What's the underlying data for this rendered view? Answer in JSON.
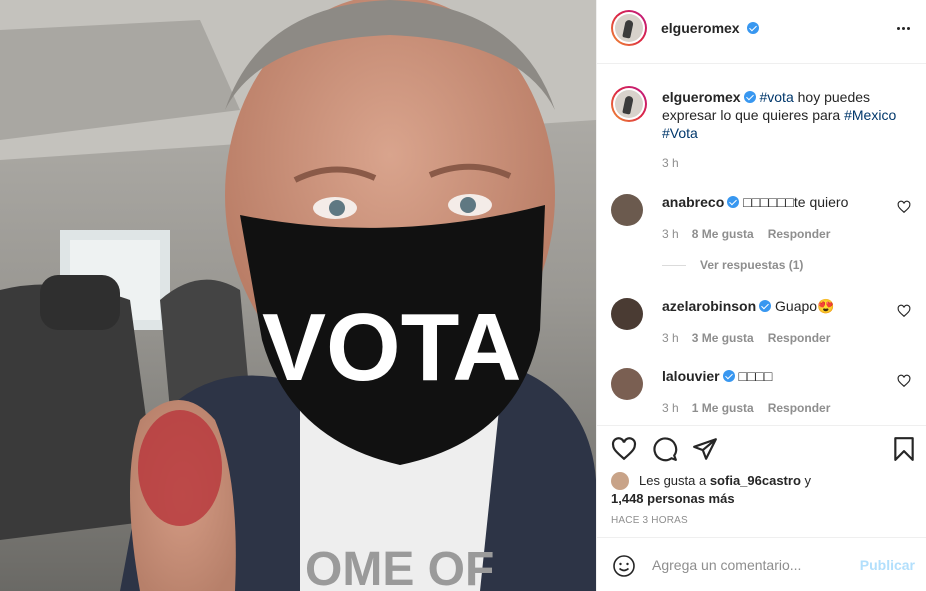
{
  "post": {
    "author": "elgueromex",
    "caption_tag1": "#vota",
    "caption_text": " hoy puedes expresar lo que quieres para ",
    "caption_tag2": "#Mexico",
    "caption_tag3": "#Vota",
    "caption_time": "3 h",
    "photo_mask_text": "VOTA",
    "photo_shirt_text": "OME OF"
  },
  "comments": [
    {
      "user": "anabreco",
      "text": "□□□□□□te quiero",
      "time": "3 h",
      "likes": "8 Me gusta",
      "reply": "Responder",
      "avatar_color": "#6b5a4e"
    },
    {
      "user": "azelarobinson",
      "text": "Guapo😍",
      "time": "3 h",
      "likes": "3 Me gusta",
      "reply": "Responder",
      "avatar_color": "#4a3b33"
    },
    {
      "user": "lalouvier",
      "text": "□□□□",
      "time": "3 h",
      "likes": "1 Me gusta",
      "reply": "Responder",
      "avatar_color": "#7a5f52"
    }
  ],
  "view_replies": "Ver respuestas (1)",
  "likes": {
    "prefix": "Les gusta a ",
    "user": "sofia_96castro",
    "joiner": " y ",
    "others": "1,448 personas más"
  },
  "posted_ago": "HACE 3 HORAS",
  "add_comment": {
    "placeholder": "Agrega un comentario...",
    "publish": "Publicar"
  },
  "colors": {
    "accent": "#3897f0",
    "hashtag": "#00376b",
    "publish_disabled": "#b2dffc"
  },
  "icons": [
    "heart-icon",
    "comment-icon",
    "share-icon",
    "bookmark-icon",
    "emoji-icon",
    "more-options-icon",
    "verified-icon"
  ]
}
